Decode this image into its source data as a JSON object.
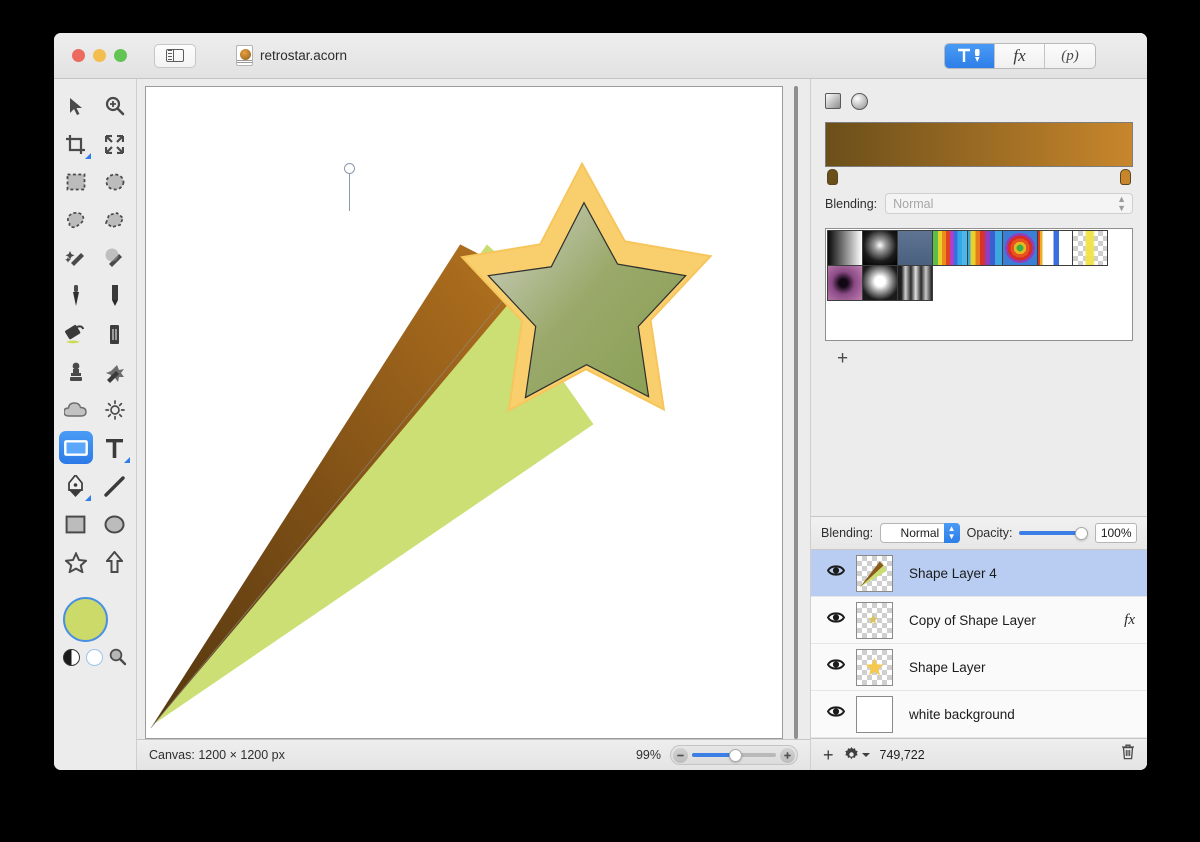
{
  "window": {
    "title": "retrostar.acorn",
    "traffic_lights": [
      "close",
      "minimize",
      "zoom"
    ],
    "sidebar_toggle": "sidebar-toggle"
  },
  "inspector_tabs": [
    {
      "id": "tools",
      "label": "",
      "icon": "hammer-brush-icon",
      "active": true
    },
    {
      "id": "filters",
      "label": "fx",
      "icon": "fx-icon",
      "active": false
    },
    {
      "id": "presets",
      "label": "(p)",
      "icon": "p-icon",
      "active": false
    }
  ],
  "toolbar": {
    "tools": [
      {
        "name": "move-tool",
        "row": 1,
        "col": 1
      },
      {
        "name": "zoom-tool",
        "row": 1,
        "col": 2
      },
      {
        "name": "crop-tool",
        "row": 2,
        "col": 1
      },
      {
        "name": "transform-tool",
        "row": 2,
        "col": 2
      },
      {
        "name": "rectangular-select-tool",
        "row": 3,
        "col": 1
      },
      {
        "name": "elliptical-select-tool",
        "row": 3,
        "col": 2
      },
      {
        "name": "lasso-tool",
        "row": 4,
        "col": 1
      },
      {
        "name": "polygon-lasso-tool",
        "row": 4,
        "col": 2
      },
      {
        "name": "magic-wand-tool",
        "row": 5,
        "col": 1
      },
      {
        "name": "instant-alpha-tool",
        "row": 5,
        "col": 2
      },
      {
        "name": "brush-tool",
        "row": 6,
        "col": 1
      },
      {
        "name": "pencil-tool",
        "row": 6,
        "col": 2
      },
      {
        "name": "paint-bucket-tool",
        "row": 7,
        "col": 1
      },
      {
        "name": "eraser-tool",
        "row": 7,
        "col": 2
      },
      {
        "name": "clone-stamp-tool",
        "row": 8,
        "col": 1
      },
      {
        "name": "smudge-tool",
        "row": 8,
        "col": 2
      },
      {
        "name": "blur-tool",
        "row": 9,
        "col": 1
      },
      {
        "name": "dodge-tool",
        "row": 9,
        "col": 2
      },
      {
        "name": "shape-rectangle-tool",
        "row": 10,
        "col": 1,
        "selected": true
      },
      {
        "name": "text-tool",
        "row": 10,
        "col": 2
      },
      {
        "name": "bezier-pen-tool",
        "row": 11,
        "col": 1
      },
      {
        "name": "line-tool",
        "row": 11,
        "col": 2
      },
      {
        "name": "rectangle-tool",
        "row": 12,
        "col": 1
      },
      {
        "name": "ellipse-tool",
        "row": 12,
        "col": 2
      },
      {
        "name": "star-tool",
        "row": 13,
        "col": 1
      },
      {
        "name": "arrow-tool",
        "row": 13,
        "col": 2
      }
    ],
    "foreground_color": "#ccda69",
    "swatch_ring_color": "#4a90e2"
  },
  "gradient_panel": {
    "type_linear": "linear-gradient-type",
    "type_radial": "radial-gradient-type",
    "gradient_start_color": "#6b4f1a",
    "gradient_end_color": "#c8862c",
    "blending_label": "Blending:",
    "blending_value": "Normal",
    "presets_count": 11,
    "add_label": "+"
  },
  "layers_panel": {
    "blending_label": "Blending:",
    "blending_value": "Normal",
    "opacity_label": "Opacity:",
    "opacity_value": "100%",
    "opacity_percent": 100,
    "layers": [
      {
        "name": "Shape Layer 4",
        "visible": true,
        "selected": true,
        "has_fx": false,
        "thumb": "trail"
      },
      {
        "name": "Copy of Shape Layer",
        "visible": true,
        "selected": false,
        "has_fx": true,
        "fx_label": "fx",
        "thumb": "small-star"
      },
      {
        "name": "Shape Layer",
        "visible": true,
        "selected": false,
        "has_fx": false,
        "thumb": "star"
      },
      {
        "name": "white background",
        "visible": true,
        "selected": false,
        "has_fx": false,
        "thumb": "white"
      }
    ],
    "add_layer_label": "+",
    "memory_usage": "749,722",
    "gear_label": "layer-settings",
    "trash_label": "delete-layer"
  },
  "status_bar": {
    "canvas_size": "Canvas: 1200 × 1200 px",
    "zoom_level": "99%",
    "zoom_slider_percent": 47
  },
  "canvas": {
    "artwork_name": "shooting-star",
    "star_outline_color": "#f8cf6c",
    "star_fill_start": "#8fa35b",
    "star_fill_end": "#b9bfa6",
    "trail_green": "#ccdf75",
    "trail_brown_start": "#5c3c12",
    "trail_brown_end": "#b5711f",
    "gradient_handle": "gradient-control-handle"
  }
}
